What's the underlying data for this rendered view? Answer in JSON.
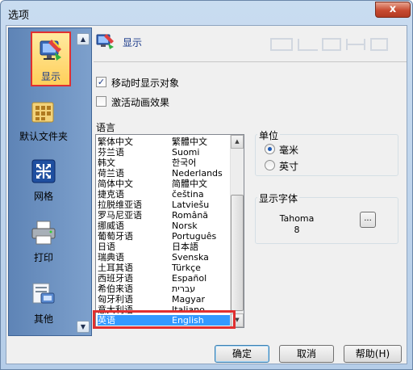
{
  "window": {
    "title": "选项",
    "close_label": "x"
  },
  "sidebar": {
    "items": [
      {
        "label": "显示",
        "icon": "display-icon",
        "active": true
      },
      {
        "label": "默认文件夹",
        "icon": "folder-icon",
        "active": false
      },
      {
        "label": "网格",
        "icon": "grid-icon",
        "active": false
      },
      {
        "label": "打印",
        "icon": "printer-icon",
        "active": false
      },
      {
        "label": "其他",
        "icon": "other-settings-icon",
        "active": false
      }
    ],
    "scroll_up": "▲",
    "scroll_down": "▼"
  },
  "page": {
    "title": "显示",
    "options": [
      {
        "label": "移动时显示对象",
        "checked": true
      },
      {
        "label": "激活动画效果",
        "checked": false
      }
    ]
  },
  "language": {
    "label": "语言",
    "items": [
      {
        "name": "繁体中文",
        "native": "繁體中文"
      },
      {
        "name": "芬兰语",
        "native": "Suomi"
      },
      {
        "name": "韩文",
        "native": "한국어"
      },
      {
        "name": "荷兰语",
        "native": "Nederlands"
      },
      {
        "name": "简体中文",
        "native": "简體中文"
      },
      {
        "name": "捷克语",
        "native": "čeština"
      },
      {
        "name": "拉脱维亚语",
        "native": "Latviešu"
      },
      {
        "name": "罗马尼亚语",
        "native": "Română"
      },
      {
        "name": "挪威语",
        "native": "Norsk"
      },
      {
        "name": "葡萄牙语",
        "native": "Português"
      },
      {
        "name": "日语",
        "native": "日本語"
      },
      {
        "name": "瑞典语",
        "native": "Svenska"
      },
      {
        "name": "土耳其语",
        "native": "Türkçe"
      },
      {
        "name": "西班牙语",
        "native": "Español"
      },
      {
        "name": "希伯来语",
        "native": "עברית"
      },
      {
        "name": "匈牙利语",
        "native": "Magyar"
      },
      {
        "name": "意大利语",
        "native": "Italiano"
      },
      {
        "name": "英语",
        "native": "English"
      }
    ],
    "selected": "英语"
  },
  "units": {
    "label": "单位",
    "options": [
      {
        "label": "毫米",
        "selected": true
      },
      {
        "label": "英寸",
        "selected": false
      }
    ]
  },
  "display_font": {
    "label": "显示字体",
    "font_name": "Tahoma",
    "font_size": "8",
    "browse_label": "..."
  },
  "buttons": {
    "ok": "确定",
    "cancel": "取消",
    "help": "帮助(H)"
  }
}
